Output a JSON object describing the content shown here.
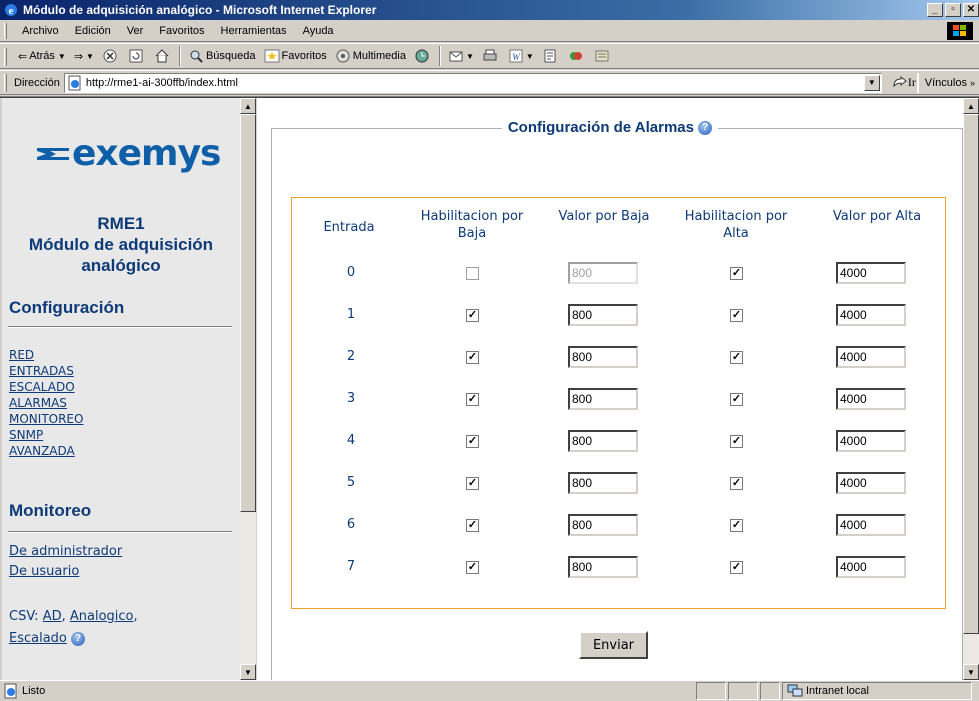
{
  "window": {
    "title": "Módulo de adquisición analógico - Microsoft Internet Explorer"
  },
  "menu": [
    "Archivo",
    "Edición",
    "Ver",
    "Favoritos",
    "Herramientas",
    "Ayuda"
  ],
  "toolbar": {
    "back": "Atrás",
    "search": "Búsqueda",
    "favorites": "Favoritos",
    "multimedia": "Multimedia"
  },
  "address": {
    "label": "Dirección",
    "url": "http://rme1-ai-300ffb/index.html",
    "go": "Ir",
    "links": "Vínculos"
  },
  "sidebar": {
    "brand": "exemys",
    "device_name": "RME1",
    "device_desc": "Módulo de adquisición analógico",
    "config_title": "Configuración",
    "config_links": [
      "RED",
      "ENTRADAS",
      "ESCALADO",
      "ALARMAS",
      "MONITOREO",
      "SNMP",
      "AVANZADA"
    ],
    "monitor_title": "Monitoreo",
    "monitor_links": [
      "De administrador",
      "De usuario"
    ],
    "csv_label": "CSV:",
    "csv_links": [
      "AD",
      "Analogico",
      "Escalado"
    ]
  },
  "main": {
    "section_title": "Configuración de Alarmas",
    "headers": {
      "input": "Entrada",
      "low_enable": "Habilitacion por Baja",
      "low_value": "Valor por Baja",
      "high_enable": "Habilitacion por Alta",
      "high_value": "Valor por Alta"
    },
    "rows": [
      {
        "input": "0",
        "low_enabled": false,
        "low_value": "800",
        "high_enabled": true,
        "high_value": "4000"
      },
      {
        "input": "1",
        "low_enabled": true,
        "low_value": "800",
        "high_enabled": true,
        "high_value": "4000"
      },
      {
        "input": "2",
        "low_enabled": true,
        "low_value": "800",
        "high_enabled": true,
        "high_value": "4000"
      },
      {
        "input": "3",
        "low_enabled": true,
        "low_value": "800",
        "high_enabled": true,
        "high_value": "4000"
      },
      {
        "input": "4",
        "low_enabled": true,
        "low_value": "800",
        "high_enabled": true,
        "high_value": "4000"
      },
      {
        "input": "5",
        "low_enabled": true,
        "low_value": "800",
        "high_enabled": true,
        "high_value": "4000"
      },
      {
        "input": "6",
        "low_enabled": true,
        "low_value": "800",
        "high_enabled": true,
        "high_value": "4000"
      },
      {
        "input": "7",
        "low_enabled": true,
        "low_value": "800",
        "high_enabled": true,
        "high_value": "4000"
      }
    ],
    "submit": "Enviar"
  },
  "status": {
    "text": "Listo",
    "zone": "Intranet local"
  }
}
